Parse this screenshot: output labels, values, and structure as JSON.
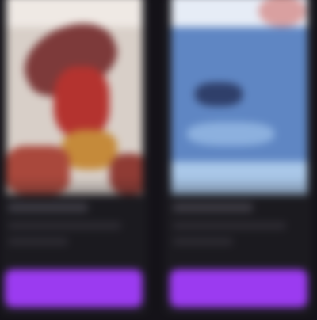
{
  "cards": [
    {
      "accent_color": "#9b3bf0",
      "poster_palette": [
        "#d8cfc8",
        "#b4332f",
        "#7d3a3a",
        "#c58a3a"
      ]
    },
    {
      "accent_color": "#9b3bf0",
      "poster_palette": [
        "#5f86c3",
        "#e6ecf6",
        "#a9c7e8",
        "#2f3f6a"
      ]
    }
  ],
  "background_color": "#141218",
  "card_color": "#1b1a1f"
}
